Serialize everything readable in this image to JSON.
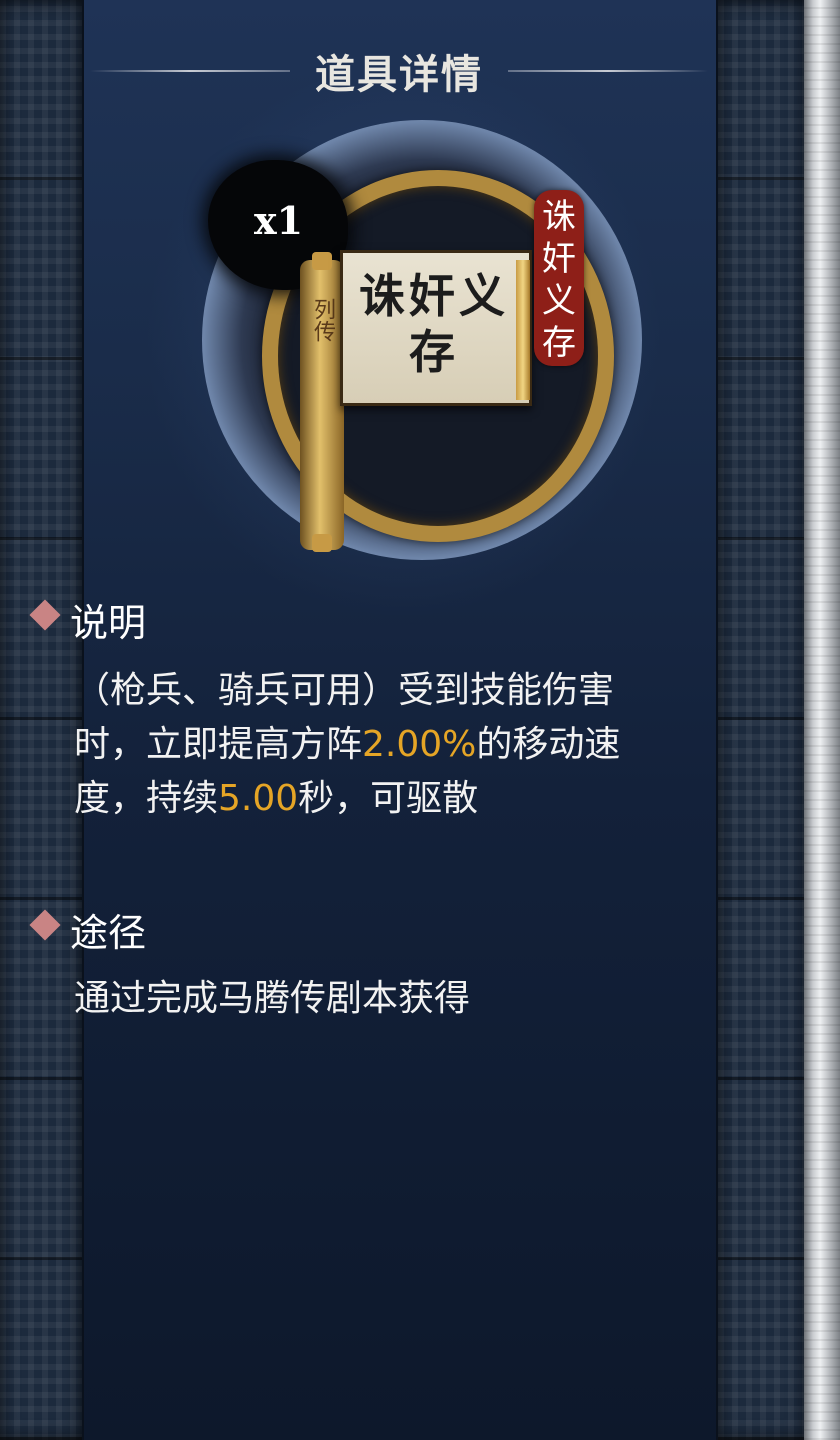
{
  "header": {
    "title": "道具详情"
  },
  "item": {
    "count": "x1",
    "scroll_side_label": "列传",
    "scroll_name": "诛奸义存",
    "tag_chars": [
      "诛",
      "奸",
      "义",
      "存"
    ],
    "colors": {
      "highlight": "#e5a526",
      "tag": "#8e1f18",
      "diamond": "#c98484"
    }
  },
  "description": {
    "title": "说明",
    "line1": "（枪兵、骑兵可用）受到技能伤害",
    "line2_pre": "时，立即提高方阵",
    "line2_value": "2.00%",
    "line2_post": "的移动速",
    "line3_pre": "度，持续",
    "line3_value": "5.00",
    "line3_post": "秒，可驱散"
  },
  "source": {
    "title": "途径",
    "text": "通过完成马腾传剧本获得"
  }
}
